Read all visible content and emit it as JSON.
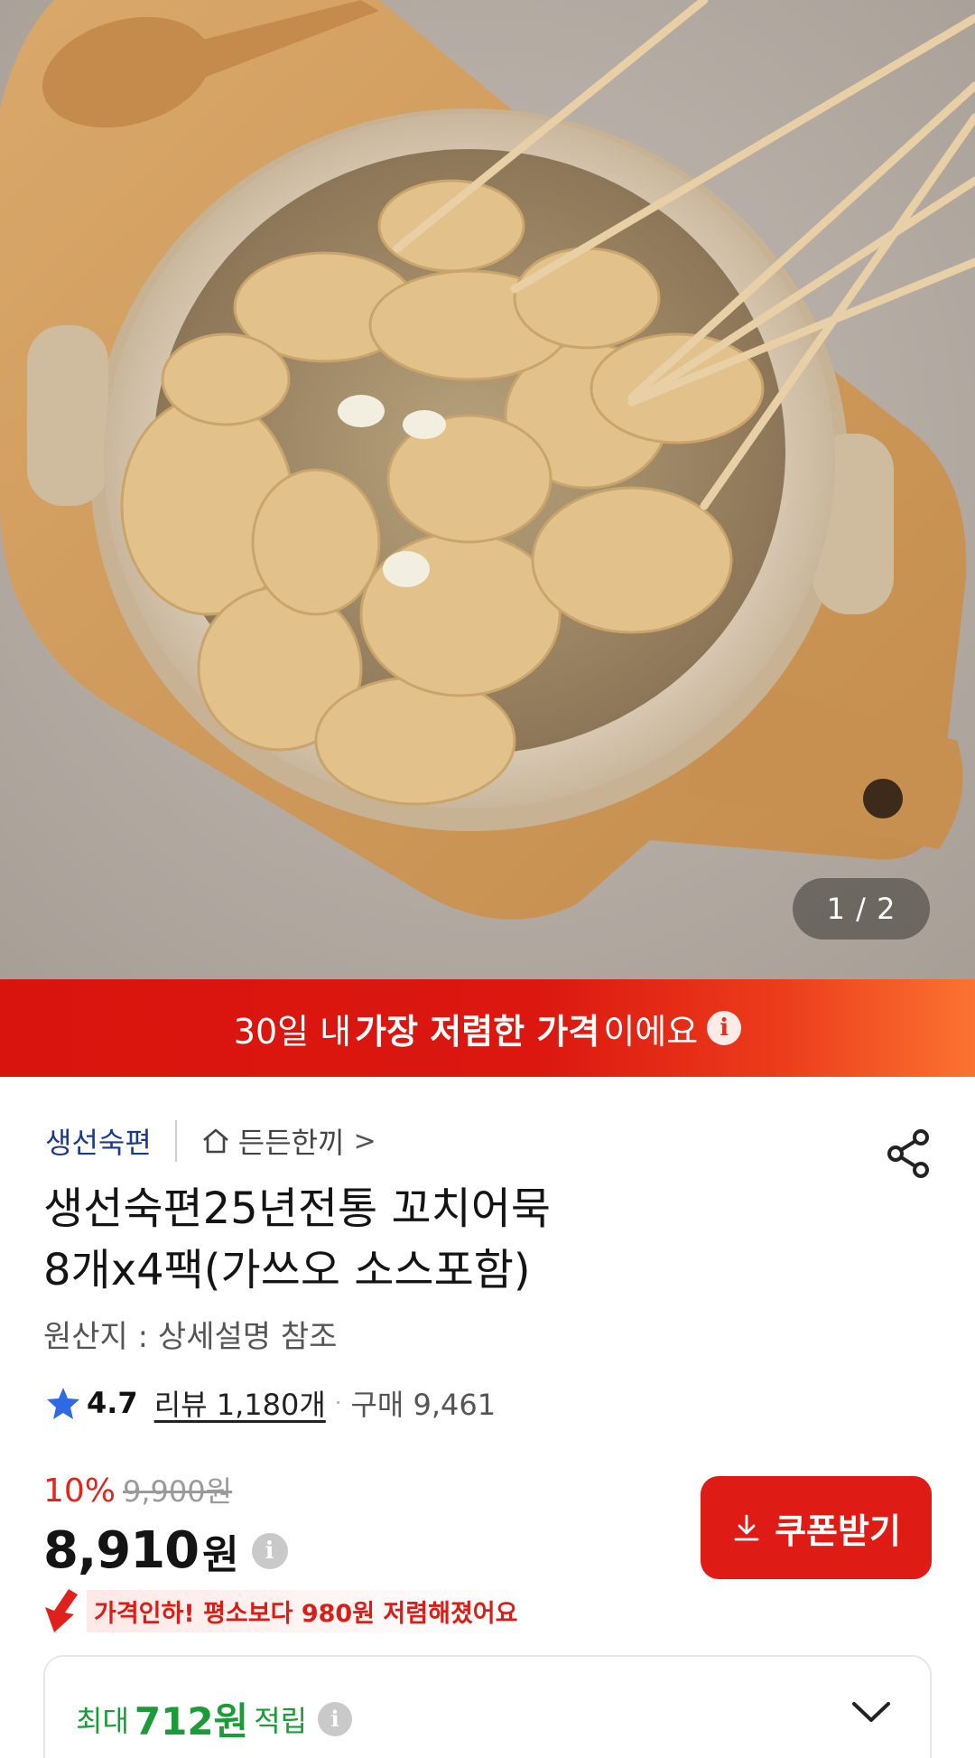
{
  "gallery": {
    "page_indicator": "1 / 2"
  },
  "promo_banner": {
    "prefix": "30일 내 ",
    "highlight": "가장 저렴한 가격",
    "suffix": "이에요",
    "info_icon": "info-icon",
    "colors": {
      "start": "#d9140e",
      "end": "#fb7330"
    }
  },
  "product": {
    "seller": "생선숙편",
    "collection": "든든한끼",
    "collection_chevron": ">",
    "title_line1": "생선숙편25년전통 꼬치어묵",
    "title_line2": "8개x4팩(가쓰오 소스포함)",
    "origin": "원산지 : 상세설명 참조",
    "rating": "4.7",
    "reviews": "리뷰 1,180개",
    "purchase_count": "구매 9,461",
    "separator": "·"
  },
  "pricing": {
    "discount_rate": "10%",
    "original_price": "9,900원",
    "sale_price": "8,910",
    "sale_unit": "원",
    "price_drop_notice": "가격인하! 평소보다 980원 저렴해졌어요",
    "coupon_button": "쿠폰받기",
    "accent_color": "#df1b16"
  },
  "points": {
    "prefix": "최대",
    "amount": "712원",
    "suffix": "적립",
    "color": "#1c9b39"
  }
}
